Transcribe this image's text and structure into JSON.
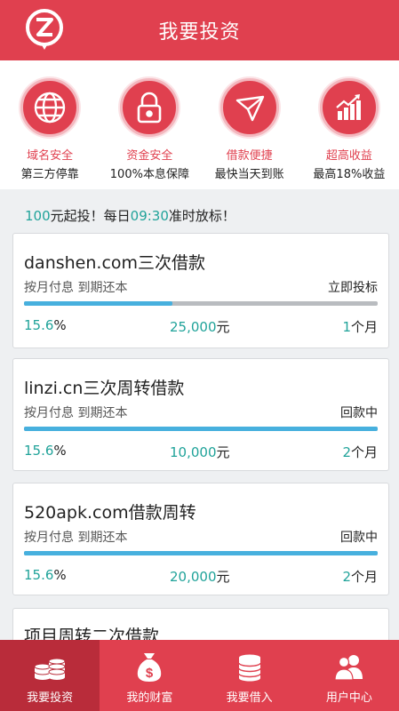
{
  "header": {
    "title": "我要投资",
    "logo_icon": "z-logo-icon"
  },
  "features": [
    {
      "icon": "globe-icon",
      "name": "域名安全",
      "desc": "第三方停靠"
    },
    {
      "icon": "lock-icon",
      "name": "资金安全",
      "desc": "100%本息保障"
    },
    {
      "icon": "paper-plane-icon",
      "name": "借款便捷",
      "desc": "最快当天到账"
    },
    {
      "icon": "bar-chart-icon",
      "name": "超高收益",
      "desc": "最高18%收益"
    }
  ],
  "notice": {
    "amount": "100",
    "part1": "元起投！每日",
    "time": "09:30",
    "part2": "准时放标！"
  },
  "loans": [
    {
      "name": "danshen.com三次借款",
      "terms": "按月付息  到期还本",
      "status": "立即投标",
      "progress": 0.42,
      "rate": "15.6",
      "rate_unit": "%",
      "amount": "25,000",
      "amount_unit": "元",
      "term": "1",
      "term_unit": "个月"
    },
    {
      "name": "linzi.cn三次周转借款",
      "terms": "按月付息  到期还本",
      "status": "回款中",
      "progress": 1.0,
      "rate": "15.6",
      "rate_unit": "%",
      "amount": "10,000",
      "amount_unit": "元",
      "term": "2",
      "term_unit": "个月"
    },
    {
      "name": "520apk.com借款周转",
      "terms": "按月付息  到期还本",
      "status": "回款中",
      "progress": 1.0,
      "rate": "15.6",
      "rate_unit": "%",
      "amount": "20,000",
      "amount_unit": "元",
      "term": "2",
      "term_unit": "个月"
    },
    {
      "name": "项目周转二次借款"
    }
  ],
  "tabs": [
    {
      "icon": "coins-stack-icon",
      "label": "我要投资",
      "active": true
    },
    {
      "icon": "money-bag-icon",
      "label": "我的财富",
      "active": false
    },
    {
      "icon": "coin-stack-icon",
      "label": "我要借入",
      "active": false
    },
    {
      "icon": "users-icon",
      "label": "用户中心",
      "active": false
    }
  ],
  "colors": {
    "brand_red": "#e0404f",
    "teal": "#21a39a",
    "progress_blue": "#47b0de"
  }
}
